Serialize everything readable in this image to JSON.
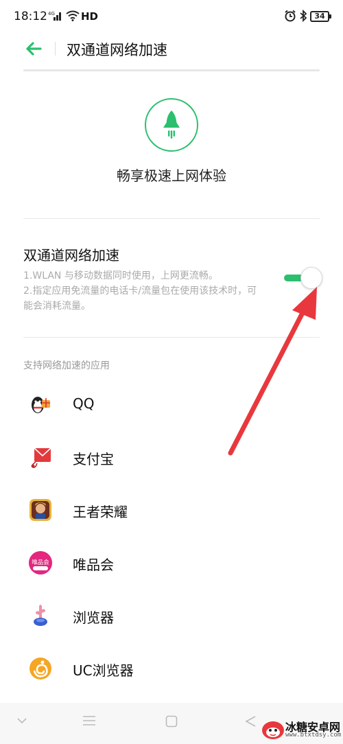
{
  "status_bar": {
    "time": "18:12",
    "network": "HD",
    "battery": "34"
  },
  "header": {
    "title": "双通道网络加速"
  },
  "hero": {
    "caption": "畅享极速上网体验",
    "icon": "rocket-icon",
    "accent_color": "#2bbf6e"
  },
  "setting": {
    "title": "双通道网络加速",
    "desc_line1": "1.WLAN 与移动数据同时使用，上网更流畅。",
    "desc_line2": "2.指定应用免流量的电话卡/流量包在使用该技术时，可能会消耗流量。",
    "enabled": true
  },
  "apps_section": {
    "header": "支持网络加速的应用",
    "items": [
      {
        "label": "QQ",
        "icon": "qq-app-icon"
      },
      {
        "label": "支付宝",
        "icon": "alipay-app-icon"
      },
      {
        "label": "王者荣耀",
        "icon": "honor-of-kings-app-icon"
      },
      {
        "label": "唯品会",
        "icon": "vipshop-app-icon"
      },
      {
        "label": "浏览器",
        "icon": "browser-app-icon"
      },
      {
        "label": "UC浏览器",
        "icon": "uc-browser-app-icon"
      }
    ]
  },
  "vipshop_icon_text": "唯品会",
  "annotation_color": "#e8383d",
  "watermark": {
    "title": "冰糖安卓网",
    "url": "www.btxtdsy.com"
  }
}
